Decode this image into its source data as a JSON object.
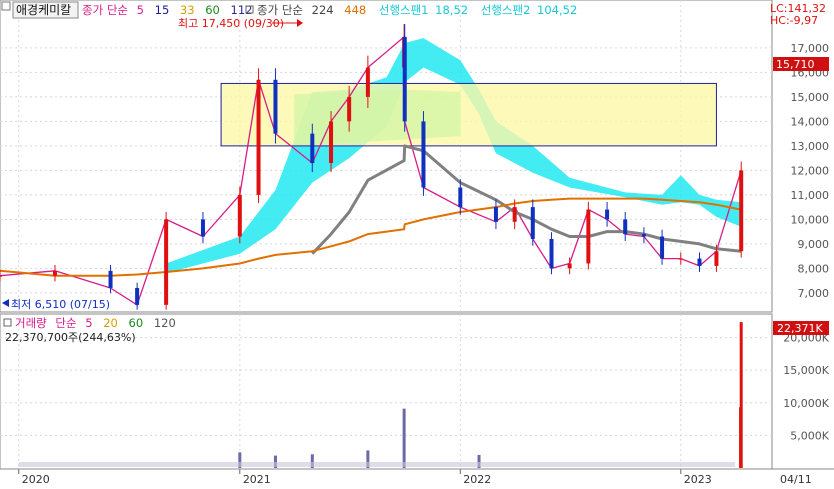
{
  "stock_name": "애경케미칼",
  "main_legend": {
    "ma_prefix": "종가 단순",
    "ma_periods": [
      "5",
      "15",
      "33",
      "60",
      "112"
    ],
    "ma_colors": [
      "#d81b8a",
      "#1a1aa0",
      "#d4a000",
      "#1a8a1a",
      "#2a2a9a"
    ],
    "ma2_prefix": "종가 단순",
    "ma2_periods": [
      "224",
      "448"
    ],
    "ma2_colors": [
      "#444444",
      "#e07000"
    ],
    "span1_label": "선행스팬1",
    "span1_value": "18,52",
    "span2_label": "선행스팬2",
    "span2_value": "104,52"
  },
  "right_info": {
    "lc": "LC:141,32",
    "hc": "HC:-9,97"
  },
  "high_annotation": "최고 17,450 (09/30)",
  "low_annotation": "최저 6,510 (07/15)",
  "price_badge": "15,710",
  "volume_legend": {
    "title": "거래량",
    "prefix": "단순",
    "periods": [
      "5",
      "20",
      "60",
      "120"
    ],
    "period_colors": [
      "#d81b8a",
      "#d4a000",
      "#1a8a1a",
      "#555555"
    ],
    "value_text": "22,370,700주(244,63%)"
  },
  "volume_badge": "22,371K",
  "x_axis_labels": [
    "2020",
    "2021",
    "2022",
    "2023",
    "04/11"
  ],
  "colors": {
    "up": "#e01010",
    "down": "#1030c0",
    "cloud": "#22e8f0",
    "cloud_green": "#2ee89a",
    "box_fill": "#fbf7a8",
    "box_stroke": "#2020a0",
    "ma224": "#808080",
    "ma448": "#e07000"
  },
  "chart_data": [
    {
      "type": "line",
      "name": "price",
      "title": "",
      "ylabel": "",
      "y_ticks": [
        7000,
        8000,
        9000,
        10000,
        11000,
        12000,
        13000,
        14000,
        15000,
        16000,
        17000
      ],
      "y_tick_labels": [
        "7,000",
        "8,000",
        "9,000",
        "10,000",
        "11,000",
        "12,000",
        "13,000",
        "14,000",
        "15,000",
        "16,000",
        "17,000"
      ],
      "ylim": [
        6300,
        17650
      ],
      "x": [
        "2019-12",
        "2020-03",
        "2020-06",
        "2020-07-15",
        "2020-09",
        "2020-11",
        "2021-01",
        "2021-02",
        "2021-03",
        "2021-05",
        "2021-06",
        "2021-07",
        "2021-08",
        "2021-09-30",
        "2021-10",
        "2021-11",
        "2022-01",
        "2022-03",
        "2022-04",
        "2022-05",
        "2022-06",
        "2022-07",
        "2022-08",
        "2022-09",
        "2022-10",
        "2022-11",
        "2022-12",
        "2023-01",
        "2023-02",
        "2023-03",
        "2023-04-11"
      ],
      "series": [
        {
          "name": "",
          "values": [
            7700,
            7900,
            7200,
            6510,
            10000,
            9300,
            11000,
            15700,
            13500,
            12300,
            14000,
            15000,
            16200,
            17450,
            14000,
            11300,
            10500,
            9900,
            10500,
            9200,
            8000,
            8200,
            10400,
            10000,
            9400,
            9300,
            8400,
            8400,
            8100,
            8700,
            12000
          ]
        },
        {
          "name": "",
          "values": [
            null,
            null,
            null,
            null,
            null,
            null,
            null,
            null,
            null,
            8600,
            9400,
            10300,
            11600,
            12400,
            13000,
            12800,
            11500,
            10800,
            10300,
            10000,
            9600,
            9300,
            9300,
            9500,
            9500,
            9400,
            9200,
            9100,
            9000,
            8800,
            8700
          ]
        },
        {
          "name": "",
          "values": [
            7900,
            7700,
            7700,
            7750,
            7850,
            8000,
            8200,
            8400,
            8550,
            8700,
            8900,
            9100,
            9400,
            9600,
            9800,
            10000,
            10300,
            10500,
            10650,
            10750,
            10800,
            10850,
            10850,
            10850,
            10850,
            10850,
            10800,
            10750,
            10700,
            10600,
            10400
          ]
        }
      ],
      "ichimoku_cloud": {
        "x": [
          "2020-09",
          "2021-01",
          "2021-03",
          "2021-05",
          "2021-07",
          "2021-09",
          "2021-10",
          "2021-11",
          "2022-01",
          "2022-02",
          "2022-03",
          "2022-05",
          "2022-07",
          "2022-10",
          "2022-12",
          "2023-01",
          "2023-02",
          "2023-03",
          "2023-04-11"
        ],
        "upper": [
          8200,
          9300,
          11200,
          15200,
          15300,
          15800,
          17200,
          17400,
          16500,
          15300,
          14000,
          13000,
          11700,
          11100,
          11000,
          11800,
          11000,
          10800,
          10700
        ],
        "lower": [
          7800,
          8600,
          9600,
          11500,
          12500,
          13800,
          15600,
          16200,
          15500,
          14300,
          12700,
          11900,
          11300,
          10900,
          10600,
          10700,
          10600,
          10100,
          9700
        ]
      },
      "highlight_box": {
        "y_range": [
          13000,
          15550
        ],
        "x_range": [
          "2020-12",
          "2023-03"
        ]
      }
    },
    {
      "type": "bar",
      "name": "volume",
      "title": "",
      "y_ticks": [
        5000,
        10000,
        15000,
        20000
      ],
      "y_tick_labels": [
        "5,000K",
        "10,000K",
        "15,000K",
        "20,000K"
      ],
      "ylim": [
        0,
        23000
      ],
      "x": [
        "2021-01",
        "2021-03",
        "2021-05",
        "2021-08",
        "2021-09-30",
        "2022-02",
        "2023-04-10",
        "2023-04-11"
      ],
      "values": [
        2400,
        1900,
        2100,
        2700,
        9100,
        2000,
        9300,
        22370
      ]
    }
  ]
}
